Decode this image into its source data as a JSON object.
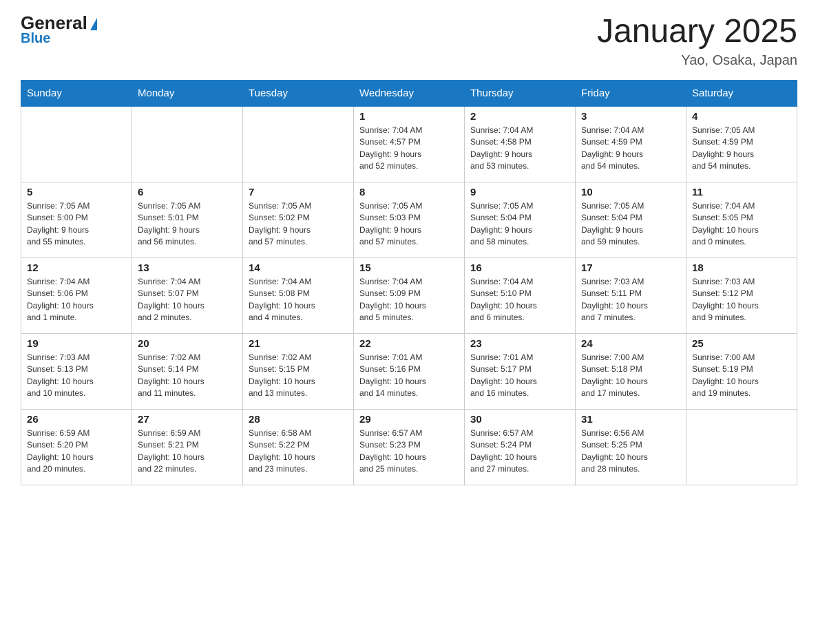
{
  "header": {
    "logo_general": "General",
    "logo_blue": "Blue",
    "title": "January 2025",
    "subtitle": "Yao, Osaka, Japan"
  },
  "days_of_week": [
    "Sunday",
    "Monday",
    "Tuesday",
    "Wednesday",
    "Thursday",
    "Friday",
    "Saturday"
  ],
  "weeks": [
    [
      {
        "day": "",
        "info": ""
      },
      {
        "day": "",
        "info": ""
      },
      {
        "day": "",
        "info": ""
      },
      {
        "day": "1",
        "info": "Sunrise: 7:04 AM\nSunset: 4:57 PM\nDaylight: 9 hours\nand 52 minutes."
      },
      {
        "day": "2",
        "info": "Sunrise: 7:04 AM\nSunset: 4:58 PM\nDaylight: 9 hours\nand 53 minutes."
      },
      {
        "day": "3",
        "info": "Sunrise: 7:04 AM\nSunset: 4:59 PM\nDaylight: 9 hours\nand 54 minutes."
      },
      {
        "day": "4",
        "info": "Sunrise: 7:05 AM\nSunset: 4:59 PM\nDaylight: 9 hours\nand 54 minutes."
      }
    ],
    [
      {
        "day": "5",
        "info": "Sunrise: 7:05 AM\nSunset: 5:00 PM\nDaylight: 9 hours\nand 55 minutes."
      },
      {
        "day": "6",
        "info": "Sunrise: 7:05 AM\nSunset: 5:01 PM\nDaylight: 9 hours\nand 56 minutes."
      },
      {
        "day": "7",
        "info": "Sunrise: 7:05 AM\nSunset: 5:02 PM\nDaylight: 9 hours\nand 57 minutes."
      },
      {
        "day": "8",
        "info": "Sunrise: 7:05 AM\nSunset: 5:03 PM\nDaylight: 9 hours\nand 57 minutes."
      },
      {
        "day": "9",
        "info": "Sunrise: 7:05 AM\nSunset: 5:04 PM\nDaylight: 9 hours\nand 58 minutes."
      },
      {
        "day": "10",
        "info": "Sunrise: 7:05 AM\nSunset: 5:04 PM\nDaylight: 9 hours\nand 59 minutes."
      },
      {
        "day": "11",
        "info": "Sunrise: 7:04 AM\nSunset: 5:05 PM\nDaylight: 10 hours\nand 0 minutes."
      }
    ],
    [
      {
        "day": "12",
        "info": "Sunrise: 7:04 AM\nSunset: 5:06 PM\nDaylight: 10 hours\nand 1 minute."
      },
      {
        "day": "13",
        "info": "Sunrise: 7:04 AM\nSunset: 5:07 PM\nDaylight: 10 hours\nand 2 minutes."
      },
      {
        "day": "14",
        "info": "Sunrise: 7:04 AM\nSunset: 5:08 PM\nDaylight: 10 hours\nand 4 minutes."
      },
      {
        "day": "15",
        "info": "Sunrise: 7:04 AM\nSunset: 5:09 PM\nDaylight: 10 hours\nand 5 minutes."
      },
      {
        "day": "16",
        "info": "Sunrise: 7:04 AM\nSunset: 5:10 PM\nDaylight: 10 hours\nand 6 minutes."
      },
      {
        "day": "17",
        "info": "Sunrise: 7:03 AM\nSunset: 5:11 PM\nDaylight: 10 hours\nand 7 minutes."
      },
      {
        "day": "18",
        "info": "Sunrise: 7:03 AM\nSunset: 5:12 PM\nDaylight: 10 hours\nand 9 minutes."
      }
    ],
    [
      {
        "day": "19",
        "info": "Sunrise: 7:03 AM\nSunset: 5:13 PM\nDaylight: 10 hours\nand 10 minutes."
      },
      {
        "day": "20",
        "info": "Sunrise: 7:02 AM\nSunset: 5:14 PM\nDaylight: 10 hours\nand 11 minutes."
      },
      {
        "day": "21",
        "info": "Sunrise: 7:02 AM\nSunset: 5:15 PM\nDaylight: 10 hours\nand 13 minutes."
      },
      {
        "day": "22",
        "info": "Sunrise: 7:01 AM\nSunset: 5:16 PM\nDaylight: 10 hours\nand 14 minutes."
      },
      {
        "day": "23",
        "info": "Sunrise: 7:01 AM\nSunset: 5:17 PM\nDaylight: 10 hours\nand 16 minutes."
      },
      {
        "day": "24",
        "info": "Sunrise: 7:00 AM\nSunset: 5:18 PM\nDaylight: 10 hours\nand 17 minutes."
      },
      {
        "day": "25",
        "info": "Sunrise: 7:00 AM\nSunset: 5:19 PM\nDaylight: 10 hours\nand 19 minutes."
      }
    ],
    [
      {
        "day": "26",
        "info": "Sunrise: 6:59 AM\nSunset: 5:20 PM\nDaylight: 10 hours\nand 20 minutes."
      },
      {
        "day": "27",
        "info": "Sunrise: 6:59 AM\nSunset: 5:21 PM\nDaylight: 10 hours\nand 22 minutes."
      },
      {
        "day": "28",
        "info": "Sunrise: 6:58 AM\nSunset: 5:22 PM\nDaylight: 10 hours\nand 23 minutes."
      },
      {
        "day": "29",
        "info": "Sunrise: 6:57 AM\nSunset: 5:23 PM\nDaylight: 10 hours\nand 25 minutes."
      },
      {
        "day": "30",
        "info": "Sunrise: 6:57 AM\nSunset: 5:24 PM\nDaylight: 10 hours\nand 27 minutes."
      },
      {
        "day": "31",
        "info": "Sunrise: 6:56 AM\nSunset: 5:25 PM\nDaylight: 10 hours\nand 28 minutes."
      },
      {
        "day": "",
        "info": ""
      }
    ]
  ]
}
